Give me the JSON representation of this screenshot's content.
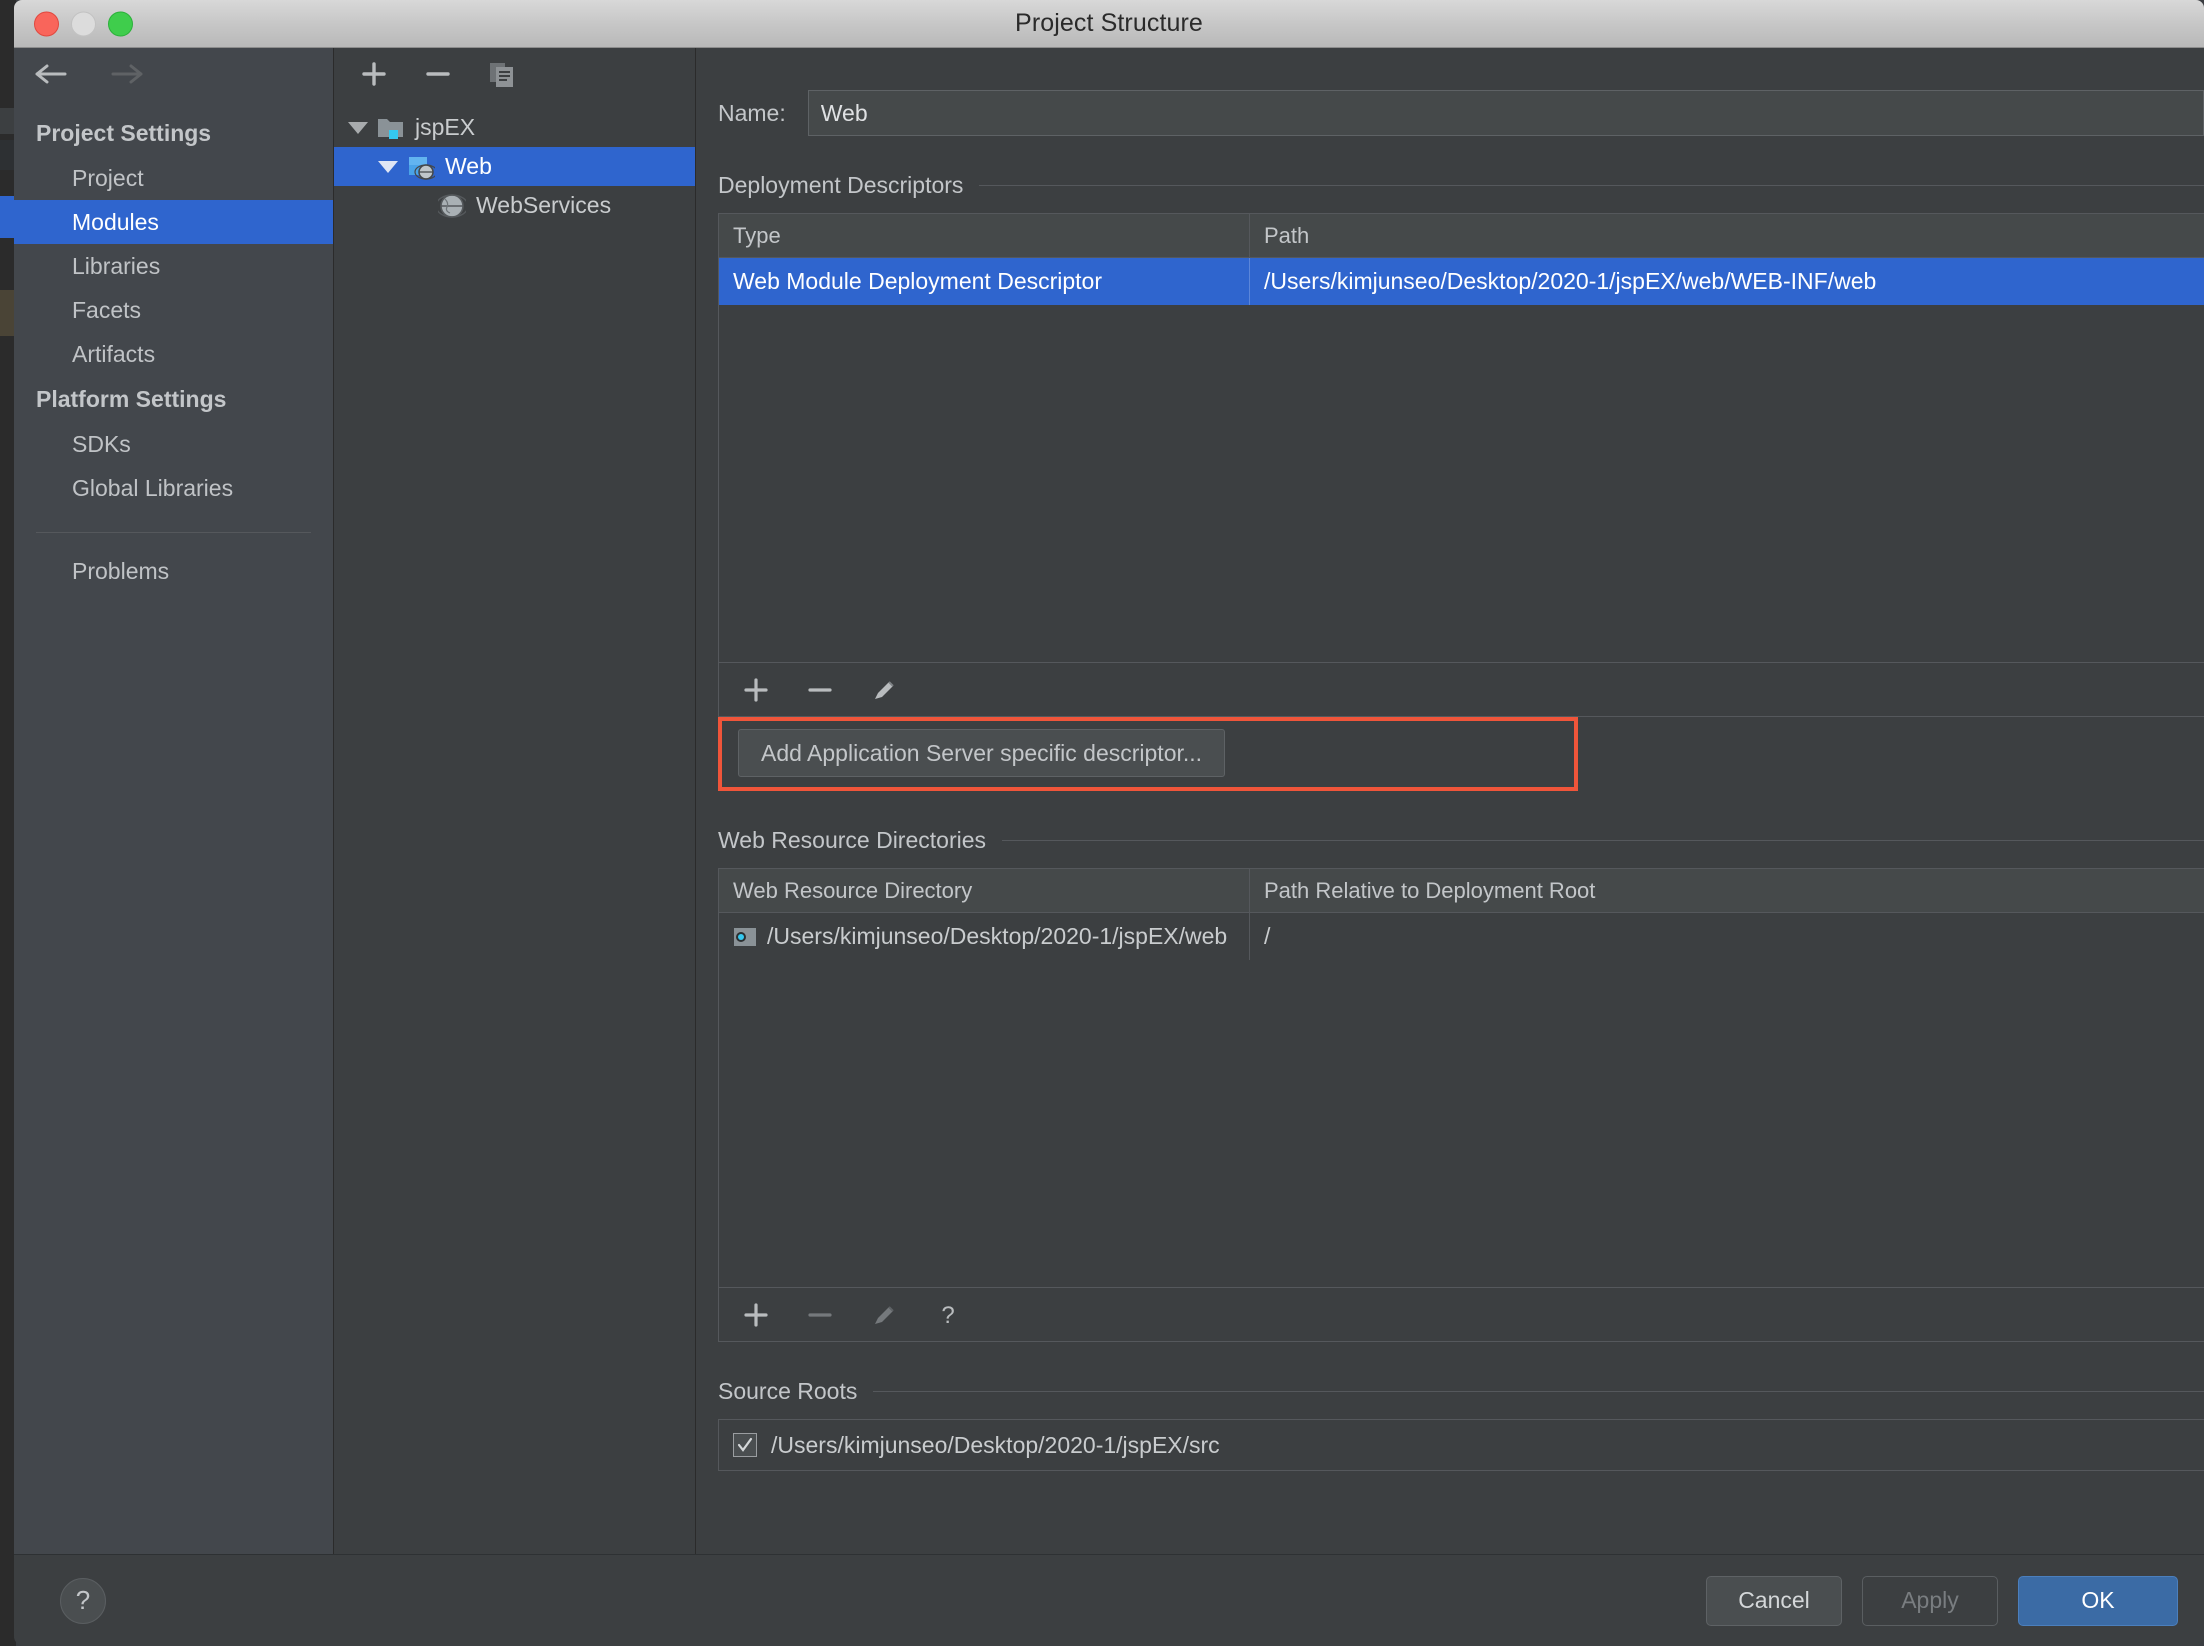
{
  "window": {
    "title": "Project Structure",
    "traffic_lights": [
      "close-red",
      "minimize-yellow",
      "zoom-green"
    ]
  },
  "navigation": {
    "back_icon": "arrow-left-icon",
    "forward_icon": "arrow-right-icon",
    "back_enabled": "true",
    "forward_enabled": "false"
  },
  "sidebar": {
    "groups": [
      {
        "header": "Project Settings",
        "items": [
          {
            "label": "Project",
            "selected": false
          },
          {
            "label": "Modules",
            "selected": true
          },
          {
            "label": "Libraries",
            "selected": false
          },
          {
            "label": "Facets",
            "selected": false
          },
          {
            "label": "Artifacts",
            "selected": false
          }
        ]
      },
      {
        "header": "Platform Settings",
        "items": [
          {
            "label": "SDKs",
            "selected": false
          },
          {
            "label": "Global Libraries",
            "selected": false
          }
        ]
      }
    ],
    "problems_label": "Problems"
  },
  "tree_panel": {
    "toolbar": [
      {
        "name": "add-module-button",
        "icon": "plus-icon"
      },
      {
        "name": "remove-module-button",
        "icon": "minus-icon"
      },
      {
        "name": "copy-module-button",
        "icon": "copy-icon"
      }
    ],
    "nodes": [
      {
        "label": "jspEX",
        "icon": "project-folder-icon",
        "depth": 0,
        "expanded": true,
        "selected": false
      },
      {
        "label": "Web",
        "icon": "web-module-icon",
        "depth": 1,
        "expanded": true,
        "selected": true
      },
      {
        "label": "WebServices",
        "icon": "globe-icon",
        "depth": 2,
        "expanded": false,
        "selected": false
      }
    ]
  },
  "content": {
    "name_field": {
      "label": "Name:",
      "value": "Web",
      "placeholder": "Module name"
    },
    "deployment_descriptors": {
      "title": "Deployment Descriptors",
      "columns": [
        "Type",
        "Path"
      ],
      "rows": [
        {
          "type": "Web Module Deployment Descriptor",
          "path": "/Users/kimjunseo/Desktop/2020-1/jspEX/web/WEB-INF/web",
          "selected": true
        }
      ],
      "toolbar": [
        {
          "name": "add-descriptor-button",
          "icon": "plus-icon",
          "enabled": true
        },
        {
          "name": "remove-descriptor-button",
          "icon": "minus-icon",
          "enabled": true
        },
        {
          "name": "edit-descriptor-button",
          "icon": "pencil-icon",
          "enabled": true
        }
      ],
      "add_app_server_descriptor_label": "Add Application Server specific descriptor...",
      "highlight_color": "#f0553a"
    },
    "web_resource_directories": {
      "title": "Web Resource Directories",
      "columns": [
        "Web Resource Directory",
        "Path Relative to Deployment Root"
      ],
      "rows": [
        {
          "directory": "/Users/kimjunseo/Desktop/2020-1/jspEX/web",
          "relative_path": "/",
          "icon": "folder-module-icon"
        }
      ],
      "toolbar": [
        {
          "name": "add-web-resource-button",
          "icon": "plus-icon",
          "enabled": true
        },
        {
          "name": "remove-web-resource-button",
          "icon": "minus-icon",
          "enabled": false
        },
        {
          "name": "edit-web-resource-button",
          "icon": "pencil-icon",
          "enabled": false
        },
        {
          "name": "web-resource-help-button",
          "icon": "question-icon",
          "enabled": true
        }
      ]
    },
    "source_roots": {
      "title": "Source Roots",
      "rows": [
        {
          "path": "/Users/kimjunseo/Desktop/2020-1/jspEX/src",
          "checked": true
        }
      ]
    }
  },
  "footer": {
    "help_label": "?",
    "cancel_label": "Cancel",
    "apply_label": "Apply",
    "apply_enabled": "false",
    "ok_label": "OK"
  },
  "colors": {
    "accent_selection": "#2f65ce",
    "ok_button": "#3b6ba5",
    "highlight_annotation": "#f0553a",
    "window_bg": "#3c3f41",
    "sidebar_bg": "#43474c"
  }
}
